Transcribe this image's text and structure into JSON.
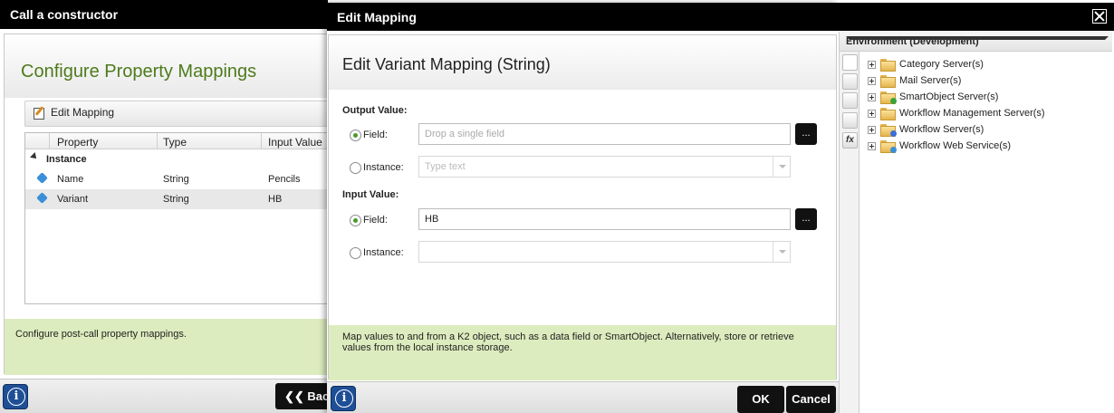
{
  "background_window": {
    "title": "Call a constructor",
    "heading": "Configure Property Mappings",
    "toolbar": {
      "edit_label": "Edit Mapping"
    },
    "grid": {
      "columns": [
        "Property",
        "Type",
        "Input Value"
      ],
      "group": "Instance",
      "rows": [
        {
          "property": "Name",
          "type": "String",
          "value": "Pencils"
        },
        {
          "property": "Variant",
          "type": "String",
          "value": "HB"
        }
      ]
    },
    "footer_text": "Configure post-call property mappings.",
    "back_label": "Back"
  },
  "dialog": {
    "title": "Edit Mapping",
    "heading": "Edit Variant Mapping (String)",
    "output": {
      "label": "Output Value:",
      "field_label": "Field:",
      "field_placeholder": "Drop a single field",
      "instance_label": "Instance:",
      "instance_placeholder": "Type text",
      "selected": "field"
    },
    "input": {
      "label": "Input Value:",
      "field_label": "Field:",
      "field_value": "HB",
      "instance_label": "Instance:",
      "instance_value": "",
      "selected": "field"
    },
    "ellipsis_label": "...",
    "footer_text": "Map values to and from a K2 object, such as a data field or SmartObject. Alternatively, store or retrieve values from the local instance storage.",
    "ok_label": "OK",
    "cancel_label": "Cancel"
  },
  "environment": {
    "title": "Environment (Development)",
    "tabs": [
      "environment-tab-icon",
      "context-browser-tab-icon",
      "process-tab-icon",
      "workflow-tab-icon",
      "fx"
    ],
    "items": [
      {
        "label": "Category Server(s)",
        "badge": ""
      },
      {
        "label": "Mail Server(s)",
        "badge": ""
      },
      {
        "label": "SmartObject Server(s)",
        "badge": "#3aa33a"
      },
      {
        "label": "Workflow Management Server(s)",
        "badge": ""
      },
      {
        "label": "Workflow Server(s)",
        "badge": "#3a6fd8"
      },
      {
        "label": "Workflow Web Service(s)",
        "badge": "#3a8fd8"
      }
    ]
  },
  "colors": {
    "heading_green": "#4e7a1c",
    "hint_green": "#ddecbe",
    "titlebar": "#000000",
    "info_blue": "#1e4f96"
  }
}
